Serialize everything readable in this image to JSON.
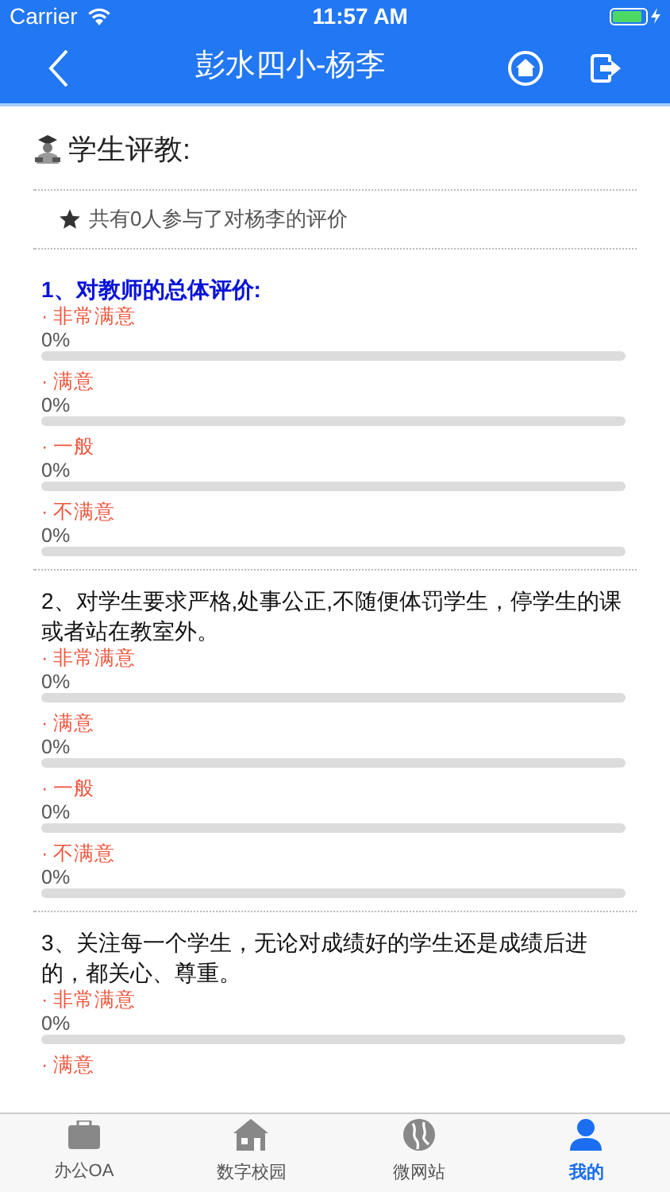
{
  "status_bar": {
    "carrier": "Carrier",
    "time": "11:57 AM"
  },
  "nav": {
    "title": "彭水四小-杨李"
  },
  "section": {
    "title": "学生评教:",
    "summary": "共有0人参与了对杨李的评价"
  },
  "questions": [
    {
      "kind": "heading",
      "title": "1、对教师的总体评价:",
      "options": [
        {
          "label": "· 非常满意",
          "percent": "0%",
          "level": 0
        },
        {
          "label": "· 满意",
          "percent": "0%",
          "level": 0
        },
        {
          "label": "· 一般",
          "percent": "0%",
          "level": 0
        },
        {
          "label": "· 不满意",
          "percent": "0%",
          "level": 0
        }
      ]
    },
    {
      "kind": "statement",
      "title": "2、对学生要求严格,处事公正,不随便体罚学生，停学生的课或者站在教室外。",
      "options": [
        {
          "label": "· 非常满意",
          "percent": "0%",
          "level": 0
        },
        {
          "label": "· 满意",
          "percent": "0%",
          "level": 0
        },
        {
          "label": "· 一般",
          "percent": "0%",
          "level": 0
        },
        {
          "label": "· 不满意",
          "percent": "0%",
          "level": 0
        }
      ]
    },
    {
      "kind": "statement",
      "title": "3、关注每一个学生，无论对成绩好的学生还是成绩后进的，都关心、尊重。",
      "options": [
        {
          "label": "· 非常满意",
          "percent": "0%",
          "level": 0
        },
        {
          "label": "· 满意"
        }
      ]
    }
  ],
  "tabs": [
    {
      "label": "办公OA",
      "kind": "briefcase",
      "selected": false
    },
    {
      "label": "数字校园",
      "kind": "school",
      "selected": false
    },
    {
      "label": "微网站",
      "kind": "globe",
      "selected": false
    },
    {
      "label": "我的",
      "kind": "person",
      "selected": true
    }
  ]
}
